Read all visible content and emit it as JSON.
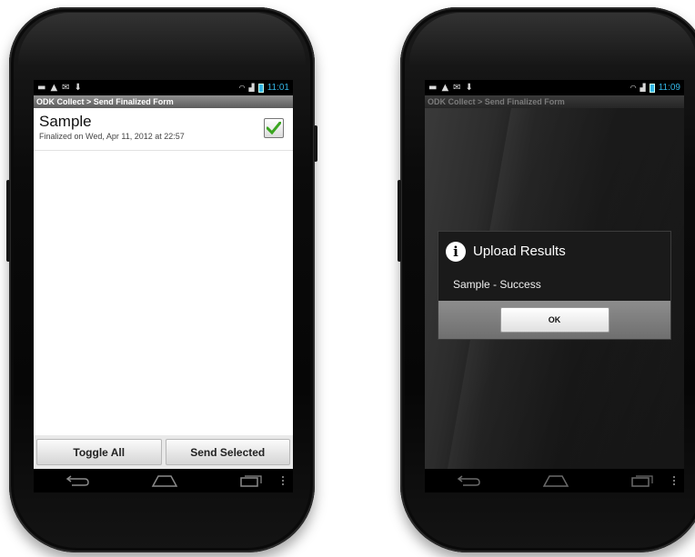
{
  "left_phone": {
    "status_time": "11:01",
    "title": "ODK Collect > Send Finalized Form",
    "form_item": {
      "name": "Sample",
      "subtitle": "Finalized on Wed, Apr 11, 2012 at 22:57",
      "checked": true
    },
    "buttons": {
      "toggle_all": "Toggle All",
      "send_selected": "Send Selected"
    }
  },
  "right_phone": {
    "status_time": "11:09",
    "title": "ODK Collect > Send Finalized Form",
    "dialog": {
      "title": "Upload Results",
      "message": "Sample - Success",
      "ok": "OK"
    }
  },
  "colors": {
    "status_time": "#33b5e5",
    "check_green": "#3aa520"
  }
}
